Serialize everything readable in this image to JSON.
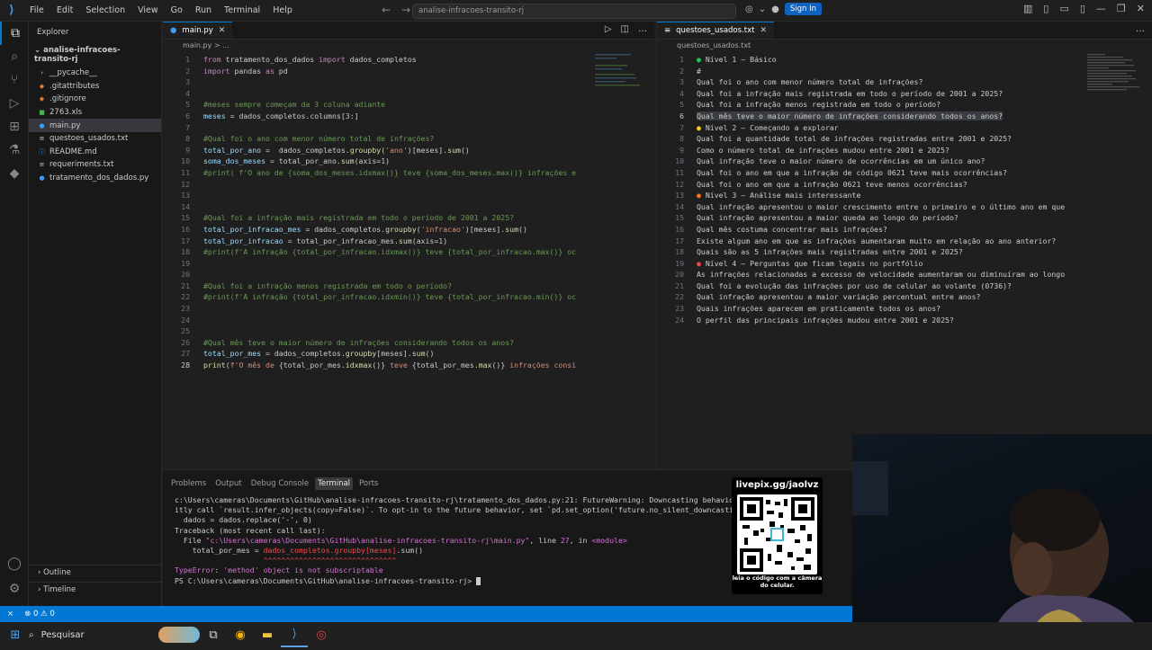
{
  "titlebar": {
    "menu": [
      "File",
      "Edit",
      "Selection",
      "View",
      "Go",
      "Run",
      "Terminal",
      "Help"
    ],
    "command_center": "analise-infracoes-transito-rj",
    "sign_in": "Sign In"
  },
  "sidebar": {
    "title": "Explorer",
    "root": "analise-infracoes-transito-rj",
    "items": [
      {
        "label": "__pycache__",
        "icon": "chevron-right-icon",
        "glyph": "›",
        "color": "#cccccc"
      },
      {
        "label": ".gitattributes",
        "icon": "git-icon",
        "glyph": "◆",
        "color": "#e37933"
      },
      {
        "label": ".gitignore",
        "icon": "git-icon",
        "glyph": "◆",
        "color": "#e37933"
      },
      {
        "label": "2763.xls",
        "icon": "spreadsheet-icon",
        "glyph": "■",
        "color": "#4caf50"
      },
      {
        "label": "main.py",
        "icon": "python-icon",
        "glyph": "●",
        "color": "#3c9cf0"
      },
      {
        "label": "questoes_usados.txt",
        "icon": "text-file-icon",
        "glyph": "≡",
        "color": "#cccccc"
      },
      {
        "label": "README.md",
        "icon": "info-icon",
        "glyph": "ⓘ",
        "color": "#3c9cf0"
      },
      {
        "label": "requeriments.txt",
        "icon": "text-file-icon",
        "glyph": "≡",
        "color": "#cccccc"
      },
      {
        "label": "tratamento_dos_dados.py",
        "icon": "python-icon",
        "glyph": "●",
        "color": "#3c9cf0"
      }
    ],
    "outline": "Outline",
    "timeline": "Timeline"
  },
  "editor_left": {
    "tab": "main.py",
    "breadcrumb": "main.py > ...",
    "lines": [
      {
        "n": "1",
        "html": "<span class='kw'>from</span> tratamento_dos_dados <span class='kw'>import</span> dados_completos"
      },
      {
        "n": "2",
        "html": "<span class='kw'>import</span> pandas <span class='kw'>as</span> pd"
      },
      {
        "n": "3",
        "html": ""
      },
      {
        "n": "4",
        "html": ""
      },
      {
        "n": "5",
        "html": "<span class='cm'>#meses sempre começam da 3 coluna adiante</span>"
      },
      {
        "n": "6",
        "html": "<span class='var'>meses</span> = dados_completos.columns[<span class='num'>3</span>:]"
      },
      {
        "n": "7",
        "html": ""
      },
      {
        "n": "8",
        "html": "<span class='cm'>#Qual foi o ano com menor número total de infrações?</span>"
      },
      {
        "n": "9",
        "html": "<span class='var'>total_por_ano</span> =  dados_completos.<span class='fn'>groupby</span>(<span class='str'>'ano'</span>)[meses].<span class='fn'>sum</span>()"
      },
      {
        "n": "10",
        "html": "<span class='var'>soma_dos_meses</span> = total_por_ano.<span class='fn'>sum</span>(axis=<span class='num'>1</span>)"
      },
      {
        "n": "11",
        "html": "<span class='cm'>#print( f'O ano de {soma_dos_meses.idxmax()} teve {soma_dos_meses.max()} infrações e</span>"
      },
      {
        "n": "12",
        "html": ""
      },
      {
        "n": "13",
        "html": ""
      },
      {
        "n": "14",
        "html": ""
      },
      {
        "n": "15",
        "html": "<span class='cm'>#Qual foi a infração mais registrada em todo o período de 2001 a 2025?</span>"
      },
      {
        "n": "16",
        "html": "<span class='var'>total_por_infracao_mes</span> = dados_completos.<span class='fn'>groupby</span>(<span class='str'>'infracao'</span>)[meses].<span class='fn'>sum</span>()"
      },
      {
        "n": "17",
        "html": "<span class='var'>total_por_infracao</span> = total_por_infracao_mes.<span class='fn'>sum</span>(axis=<span class='num'>1</span>)"
      },
      {
        "n": "18",
        "html": "<span class='cm'>#print(f'A infração {total_por_infracao.idxmax()} teve {total_por_infracao.max()} oc</span>"
      },
      {
        "n": "19",
        "html": ""
      },
      {
        "n": "20",
        "html": ""
      },
      {
        "n": "21",
        "html": "<span class='cm'>#Qual foi a infração menos registrada em todo o período?</span>"
      },
      {
        "n": "22",
        "html": "<span class='cm'>#print(f'A infração {total_por_infracao.idxmin()} teve {total_por_infracao.min()} oc</span>"
      },
      {
        "n": "23",
        "html": ""
      },
      {
        "n": "24",
        "html": ""
      },
      {
        "n": "25",
        "html": ""
      },
      {
        "n": "26",
        "html": "<span class='cm'>#Qual mês teve o maior número de infrações considerando todos os anos?</span>"
      },
      {
        "n": "27",
        "html": "<span class='var'>total_por_mes</span> = dados_completos.<span class='fn'>groupby</span>[meses].<span class='fn'>sum</span>()"
      },
      {
        "n": "28",
        "html": "<span class='fn'>print</span>(<span class='str'>f'O mês de </span>{total_por_mes.<span class='fn'>idxmax</span>()}<span class='str'> teve </span>{total_por_mes.<span class='fn'>max</span>()}<span class='str'> infrações consi</span>"
      }
    ]
  },
  "editor_right": {
    "tab": "questoes_usados.txt",
    "breadcrumb": "questoes_usados.txt",
    "lines": [
      {
        "n": "1",
        "dot": "#22c55e",
        "text": "Nível 1 – Básico"
      },
      {
        "n": "2",
        "text": "#"
      },
      {
        "n": "3",
        "text": "Qual foi o ano com menor número total de infrações?"
      },
      {
        "n": "4",
        "text": "Qual foi a infração mais registrada em todo o período de 2001 a 2025?"
      },
      {
        "n": "5",
        "text": "Qual foi a infração menos registrada em todo o período?"
      },
      {
        "n": "6",
        "text": "Qual mês teve o maior número de infrações considerando todos os anos?"
      },
      {
        "n": "7",
        "dot": "#facc15",
        "text": "Nível 2 – Começando a explorar"
      },
      {
        "n": "8",
        "text": "Qual foi a quantidade total de infrações registradas entre 2001 e 2025?"
      },
      {
        "n": "9",
        "text": "Como o número total de infrações mudou entre 2001 e 2025?"
      },
      {
        "n": "10",
        "text": "Qual infração teve o maior número de ocorrências em um único ano?"
      },
      {
        "n": "11",
        "text": "Qual foi o ano em que a infração de código 0621 teve mais ocorrências?"
      },
      {
        "n": "12",
        "text": "Qual foi o ano em que a infração 0621 teve menos ocorrências?"
      },
      {
        "n": "13",
        "dot": "#f97316",
        "text": "Nível 3 – Análise mais interessante"
      },
      {
        "n": "14",
        "text": "Qual infração apresentou o maior crescimento entre o primeiro e o último ano em que"
      },
      {
        "n": "15",
        "text": "Qual infração apresentou a maior queda ao longo do período?"
      },
      {
        "n": "16",
        "text": "Qual mês costuma concentrar mais infrações?"
      },
      {
        "n": "17",
        "text": "Existe algum ano em que as infrações aumentaram muito em relação ao ano anterior?"
      },
      {
        "n": "18",
        "text": "Quais são as 5 infrações mais registradas entre 2001 e 2025?"
      },
      {
        "n": "19",
        "dot": "#ef4444",
        "text": "Nível 4 – Perguntas que ficam legais no portfólio"
      },
      {
        "n": "20",
        "text": "As infrações relacionadas a excesso de velocidade aumentaram ou diminuíram ao longo"
      },
      {
        "n": "21",
        "text": "Qual foi a evolução das infrações por uso de celular ao volante (0736)?"
      },
      {
        "n": "22",
        "text": "Qual infração apresentou a maior variação percentual entre anos?"
      },
      {
        "n": "23",
        "text": "Quais infrações aparecem em praticamente todos os anos?"
      },
      {
        "n": "24",
        "text": "O perfil das principais infrações mudou entre 2001 e 2025?"
      }
    ]
  },
  "panel": {
    "tabs": [
      "Problems",
      "Output",
      "Debug Console",
      "Terminal",
      "Ports"
    ],
    "terminal_html": "c:\\Users\\cameras\\Documents\\GitHub\\analise-infracoes-transito-rj\\tratamento_dos_dados.py:21: FutureWarning: Downcasting behavior in `r\nitly call `result.infer_objects(copy=False)`. To opt-in to the future behavior, set `pd.set_option('future.no_silent_downcasting', Tr\n  dados = dados.replace('-', 0)\nTraceback (most recent call last):\n  File <span class='mag'>\"c:\\Users\\cameras\\Documents\\GitHub\\analise-infracoes-transito-rj\\main.py\"</span>, line <span class='mag'>27</span>, in <span class='mag'>&lt;module&gt;</span>\n    total_por_mes = <span class='red'>dados_completos.groupby[meses]</span>.sum()\n                    <span class='red'>^^^^^^^^^^^^^^^^^^^^^^^^^^^^^^</span>\n<span class='mag'>TypeError</span>: <span class='mag'>'method' object is not subscriptable</span>\nPS C:\\Users\\cameras\\Documents\\GitHub\\analise-infracoes-transito-rj> "
  },
  "statusbar": {
    "remote": "⨯",
    "problems": "⊗ 0 ⚠ 0"
  },
  "taskbar": {
    "search": "Pesquisar"
  },
  "overlay": {
    "qr_title": "livepix.gg/jaolvz",
    "qr_subtitle": "leia o código com a câmera do celular."
  }
}
